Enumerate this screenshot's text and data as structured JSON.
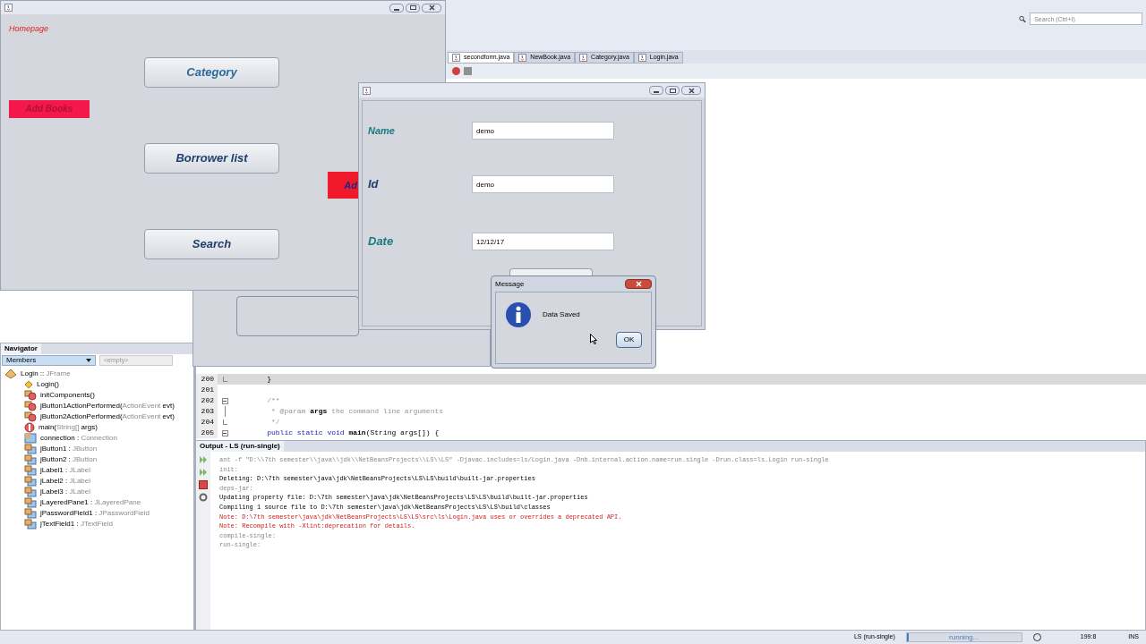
{
  "ide": {
    "search": {
      "placeholder": "Search (Ctrl+I)"
    },
    "editor_tabs": [
      {
        "label": "secondform.java",
        "selected": true
      },
      {
        "label": "NewBook.java",
        "selected": false
      },
      {
        "label": "Category.java",
        "selected": false
      },
      {
        "label": "Login.java",
        "selected": false
      }
    ],
    "code_lines": [
      {
        "number": "200",
        "current": true,
        "kind": "fold_end",
        "tokens": [
          {
            "text": "    }",
            "kind": "plain"
          }
        ]
      },
      {
        "number": "201",
        "current": false,
        "kind": "plain"
      },
      {
        "number": "202",
        "current": false,
        "kind": "fold_start",
        "tokens": [
          {
            "text": "    /**",
            "kind": "comment"
          }
        ]
      },
      {
        "number": "203",
        "current": false,
        "kind": "fold_line",
        "tokens": [
          {
            "text": "     * @param ",
            "kind": "comment"
          },
          {
            "text": "args",
            "kind": "bold"
          },
          {
            "text": " the command line arguments",
            "kind": "comment"
          }
        ]
      },
      {
        "number": "204",
        "current": false,
        "kind": "fold_end",
        "tokens": [
          {
            "text": "     */",
            "kind": "comment"
          }
        ]
      },
      {
        "number": "205",
        "current": false,
        "kind": "fold_start",
        "tokens": [
          {
            "text": "    public static void ",
            "kind": "keyword"
          },
          {
            "text": "main",
            "kind": "bold"
          },
          {
            "text": "(String args[]) {",
            "kind": "plain"
          }
        ]
      }
    ],
    "navigator": {
      "title": "Navigator",
      "filter": "Members",
      "secondary": "<empty>",
      "root": {
        "parts": [
          {
            "text": "Login :: ",
            "muted": false
          },
          {
            "text": "JFrame",
            "muted": true
          }
        ],
        "kind": "class",
        "children": [
          {
            "kind": "constructor",
            "parts": [
              {
                "text": "Login()",
                "muted": false
              }
            ]
          },
          {
            "kind": "method",
            "parts": [
              {
                "text": "initComponents()",
                "muted": false
              }
            ]
          },
          {
            "kind": "method",
            "parts": [
              {
                "text": "jButton1ActionPerformed(",
                "muted": false
              },
              {
                "text": "ActionEvent",
                "muted": true
              },
              {
                "text": " evt)",
                "muted": false
              }
            ]
          },
          {
            "kind": "method",
            "parts": [
              {
                "text": "jButton2ActionPerformed(",
                "muted": false
              },
              {
                "text": "ActionEvent",
                "muted": true
              },
              {
                "text": " evt)",
                "muted": false
              }
            ]
          },
          {
            "kind": "main",
            "parts": [
              {
                "text": "main(",
                "muted": false
              },
              {
                "text": "String[]",
                "muted": true
              },
              {
                "text": " args)",
                "muted": false
              }
            ]
          },
          {
            "kind": "static_field",
            "parts": [
              {
                "text": "connection : ",
                "muted": false
              },
              {
                "text": "Connection",
                "muted": true
              }
            ]
          },
          {
            "kind": "field",
            "parts": [
              {
                "text": "jButton1 : ",
                "muted": false
              },
              {
                "text": "JButton",
                "muted": true
              }
            ]
          },
          {
            "kind": "field",
            "parts": [
              {
                "text": "jButton2 : ",
                "muted": false
              },
              {
                "text": "JButton",
                "muted": true
              }
            ]
          },
          {
            "kind": "field",
            "parts": [
              {
                "text": "jLabel1 : ",
                "muted": false
              },
              {
                "text": "JLabel",
                "muted": true
              }
            ]
          },
          {
            "kind": "field",
            "parts": [
              {
                "text": "jLabel2 : ",
                "muted": false
              },
              {
                "text": "JLabel",
                "muted": true
              }
            ]
          },
          {
            "kind": "field",
            "parts": [
              {
                "text": "jLabel3 : ",
                "muted": false
              },
              {
                "text": "JLabel",
                "muted": true
              }
            ]
          },
          {
            "kind": "field",
            "parts": [
              {
                "text": "jLayeredPane1 : ",
                "muted": false
              },
              {
                "text": "JLayeredPane",
                "muted": true
              }
            ]
          },
          {
            "kind": "field",
            "parts": [
              {
                "text": "jPasswordField1 : ",
                "muted": false
              },
              {
                "text": "JPasswordField",
                "muted": true
              }
            ]
          },
          {
            "kind": "field",
            "parts": [
              {
                "text": "jTextField1 : ",
                "muted": false
              },
              {
                "text": "JTextField",
                "muted": true
              }
            ]
          }
        ]
      }
    },
    "output": {
      "title": "Output - LS (run-single)",
      "lines": [
        {
          "kind": "muted",
          "text": "ant -f \"D:\\\\7th semester\\\\java\\\\jdk\\\\NetBeansProjects\\\\LS\\\\LS\" -Djavac.includes=ls/Login.java -Dnb.internal.action.name=run.single -Drun.class=ls.Login run-single"
        },
        {
          "kind": "muted",
          "text": "init:"
        },
        {
          "kind": "normal",
          "text": "Deleting: D:\\7th semester\\java\\jdk\\NetBeansProjects\\LS\\LS\\build\\built-jar.properties"
        },
        {
          "kind": "muted",
          "text": "deps-jar:"
        },
        {
          "kind": "normal",
          "text": "Updating property file: D:\\7th semester\\java\\jdk\\NetBeansProjects\\LS\\LS\\build\\built-jar.properties"
        },
        {
          "kind": "normal",
          "text": "Compiling 1 source file to D:\\7th semester\\java\\jdk\\NetBeansProjects\\LS\\LS\\build\\classes"
        },
        {
          "kind": "error",
          "text": "Note: D:\\7th semester\\java\\jdk\\NetBeansProjects\\LS\\LS\\src\\ls\\Login.java uses or overrides a deprecated API."
        },
        {
          "kind": "error",
          "text": "Note: Recompile with -Xlint:deprecation for details."
        },
        {
          "kind": "muted",
          "text": "compile-single:"
        },
        {
          "kind": "muted",
          "text": "run-single:"
        }
      ]
    },
    "status_bar": {
      "task": "LS (run-single)",
      "progress": "running...",
      "level": 0.02,
      "position": "199:8",
      "mode": "INS"
    }
  },
  "homepage": {
    "title": "Homepage",
    "add_books": "Add Books",
    "buttons": [
      "Category",
      "Borrower list",
      "Search"
    ]
  },
  "hidden_button": {
    "text": "Ad"
  },
  "form": {
    "fields": [
      {
        "label": "Name",
        "value": "demo",
        "kind": "small"
      },
      {
        "label": "Id",
        "value": "demo",
        "kind": "large"
      },
      {
        "label": "Date",
        "value": "12/12/17",
        "kind": "large"
      }
    ]
  },
  "message": {
    "title": "Message",
    "text": "Data Saved",
    "ok": "OK"
  }
}
